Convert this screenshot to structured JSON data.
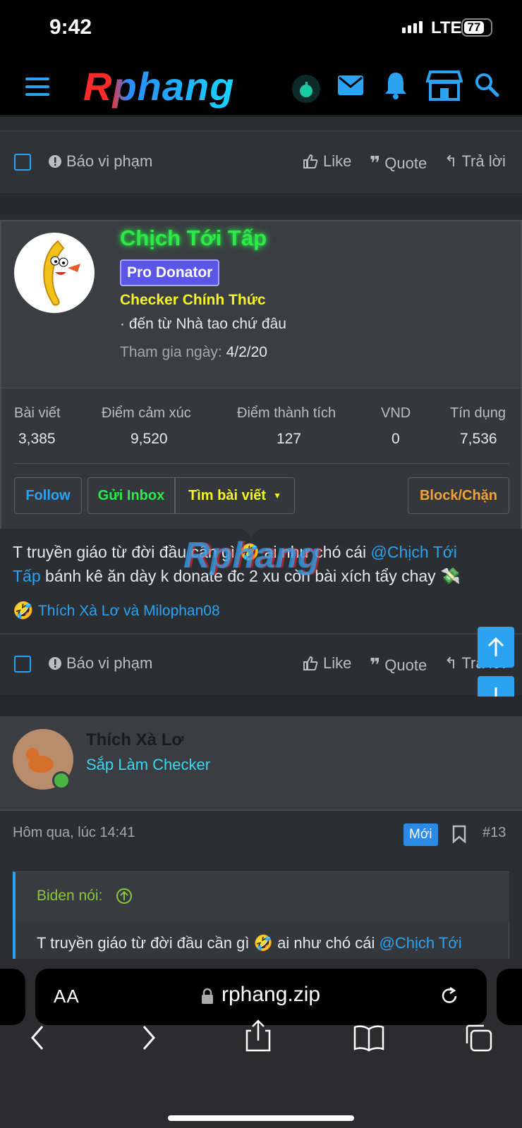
{
  "status": {
    "time": "9:42",
    "network": "LTE",
    "battery": "77"
  },
  "header": {
    "logo": "Rphang"
  },
  "post_actions": {
    "report": "Báo vi phạm",
    "like": "Like",
    "quote": "Quote",
    "reply": "Trả lời"
  },
  "member": {
    "name": "Chịch Tới Tấp",
    "badge": "Pro Donator",
    "title": "Checker Chính Thức",
    "location": "· đến từ Nhà tao chứ đâu",
    "joined_label": "Tham gia ngày:",
    "joined_value": "4/2/20",
    "stats": [
      {
        "label": "Bài viết",
        "value": "3,385"
      },
      {
        "label": "Điểm cảm xúc",
        "value": "9,520"
      },
      {
        "label": "Điểm thành tích",
        "value": "127"
      },
      {
        "label": "VND",
        "value": "0"
      },
      {
        "label": "Tín dụng",
        "value": "7,536"
      }
    ],
    "buttons": {
      "follow": "Follow",
      "inbox": "Gửi Inbox",
      "find": "Tìm bài viết",
      "block": "Block/Chặn"
    }
  },
  "post": {
    "text_before": "T truyền giáo từ đời đầu cần gì",
    "text_mid": "ai như chó cái",
    "mention_1": "@Chịch Tới",
    "mention_2": "Tấp",
    "text_after": "bánh kê ăn dày k donate đc 2 xu còn bài xích tẩy chay",
    "watermark": "Rphang",
    "reactions": "Thích Xà Lơ và Milophan08"
  },
  "next_post": {
    "author": "Thích Xà Lơ",
    "rank": "Sắp Làm Checker",
    "time": "Hôm qua, lúc 14:41",
    "new_badge": "Mới",
    "number": "#13",
    "quote_author": "Biden nói:",
    "quote_text_before": "T truyền giáo từ đời đầu cần gì",
    "quote_text_mid": "ai như chó cái",
    "quote_mention": "@Chịch Tới"
  },
  "browser": {
    "text_size": "AA",
    "url": "rphang.zip"
  },
  "colors": {
    "accent": "#2ba3f0",
    "name_green": "#2ee94a",
    "badge_purple": "#5b55e8",
    "title_yellow": "#f5f523",
    "block_orange": "#f0a23a"
  }
}
